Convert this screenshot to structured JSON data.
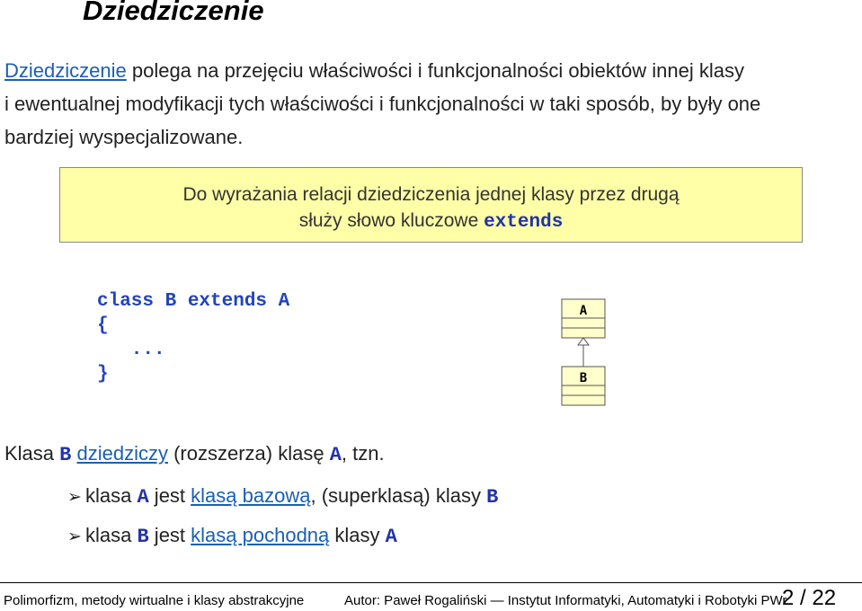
{
  "title": "Dziedziczenie",
  "intro": {
    "link": "Dziedziczenie",
    "line1_rest": " polega na przejęciu właściwości i funkcjonalności obiektów innej klasy",
    "line2": "i ewentualnej modyfikacji tych właściwości i funkcjonalności w taki sposób, by były one",
    "line3": "bardziej wyspecjalizowane."
  },
  "note": {
    "line1": "Do wyrażania relacji dziedziczenia jednej klasy przez drugą",
    "line2_text": "służy słowo kluczowe ",
    "line2_code": "extends"
  },
  "code": {
    "line1": "class B extends A",
    "line2": "{",
    "line3": "   ...",
    "line4": "}"
  },
  "uml": {
    "class_a": "A",
    "class_b": "B"
  },
  "explanation": {
    "p1": "Klasa ",
    "c1": "B",
    "p2": " ",
    "link": "dziedziczy",
    "p3": " (rozszerza) klasę ",
    "c2": "A",
    "p4": ", tzn."
  },
  "bullets": [
    {
      "p1": "klasa ",
      "c1": "A",
      "p2": " jest ",
      "link": "klasą bazową",
      "p3": ", (superklasą) klasy ",
      "c2": "B"
    },
    {
      "p1": "klasa ",
      "c1": "B",
      "p2": " jest ",
      "link": "klasą pochodną",
      "p3": " klasy ",
      "c2": "A"
    }
  ],
  "footer": {
    "left": "Polimorfizm, metody wirtualne i klasy abstrakcyjne",
    "middle": "Autor: Paweł Rogaliński — Instytut Informatyki, Automatyki i Robotyki PWr",
    "page": "2 / 22"
  },
  "colors": {
    "code": "#2244bb",
    "link": "#1a5fb4",
    "note_bg": "#ffffa8"
  }
}
